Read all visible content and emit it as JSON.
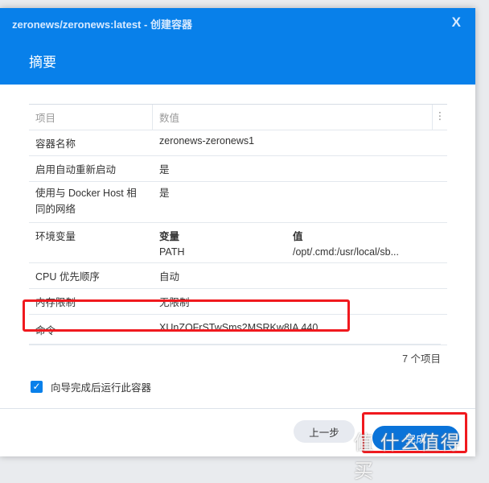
{
  "window": {
    "title": "zeronews/zeronews:latest - 创建容器",
    "close": "X",
    "heading": "摘要"
  },
  "table": {
    "headers": [
      "项目",
      "数值"
    ],
    "rows": [
      {
        "label": "容器名称",
        "value": "zeronews-zeronews1"
      },
      {
        "label": "启用自动重新启动",
        "value": "是"
      },
      {
        "label": "使用与 Docker Host 相同的网络",
        "value": "是"
      },
      {
        "label": "环境变量",
        "env_headers": [
          "变量",
          "值"
        ],
        "env": [
          [
            "PATH",
            "/opt/.cmd:/usr/local/sb..."
          ]
        ]
      },
      {
        "label": "CPU 优先顺序",
        "value": "自动"
      },
      {
        "label": "内存限制",
        "value": "无限制"
      },
      {
        "label": "命令",
        "value": "XUnZOFrSTwSms2MSRKw8IA 440"
      }
    ],
    "count": "7 个项目"
  },
  "checkbox": {
    "label": "向导完成后运行此容器",
    "checked": true
  },
  "buttons": {
    "prev": "上一步",
    "done": "完成"
  },
  "watermark": "值 什么值得买"
}
